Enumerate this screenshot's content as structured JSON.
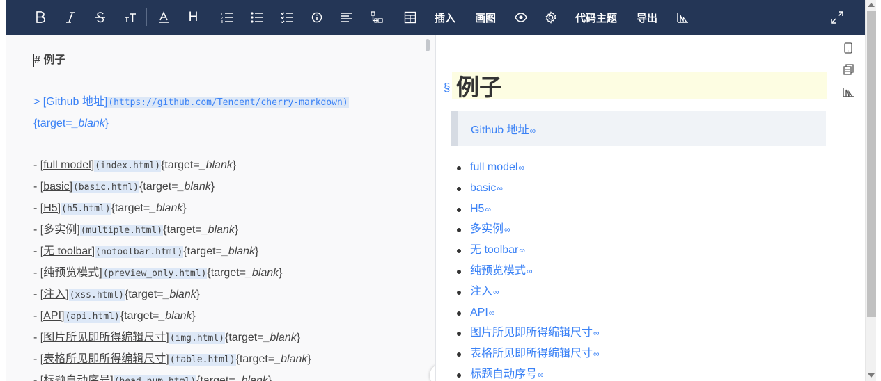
{
  "toolbar": {
    "insert_label": "插入",
    "draw_label": "画图",
    "code_theme_label": "代码主题",
    "export_label": "导出",
    "heading_letter": "H"
  },
  "editor": {
    "heading_line": "# 例子",
    "quote_prefix": "> ",
    "quote_link_text": "[Github 地址]",
    "quote_link_url": "(https://github.com/Tencent/cherry-markdown)",
    "quote_attr_open": "{target=",
    "quote_attr_value": "_blank",
    "quote_attr_close": "}",
    "items": [
      {
        "prefix": "- ",
        "text": "[full model]",
        "url": "(index.html)",
        "attr": "{target=",
        "val": "_blank",
        "close": "}"
      },
      {
        "prefix": "- ",
        "text": "[basic]",
        "url": "(basic.html)",
        "attr": "{target=",
        "val": "_blank",
        "close": "}"
      },
      {
        "prefix": "- ",
        "text": "[H5]",
        "url": "(h5.html)",
        "attr": "{target=",
        "val": "_blank",
        "close": "}"
      },
      {
        "prefix": "- ",
        "text": "[多实例]",
        "url": "(multiple.html)",
        "attr": "{target=",
        "val": "_blank",
        "close": "}"
      },
      {
        "prefix": "- ",
        "text": "[无 toolbar]",
        "url": "(notoolbar.html)",
        "attr": "{target=",
        "val": "_blank",
        "close": "}"
      },
      {
        "prefix": "- ",
        "text": "[纯预览模式]",
        "url": "(preview_only.html)",
        "attr": "{target=",
        "val": "_blank",
        "close": "}"
      },
      {
        "prefix": "- ",
        "text": "[注入]",
        "url": "(xss.html)",
        "attr": "{target=",
        "val": "_blank",
        "close": "}"
      },
      {
        "prefix": "- ",
        "text": "[API]",
        "url": "(api.html)",
        "attr": "{target=",
        "val": "_blank",
        "close": "}"
      },
      {
        "prefix": "- ",
        "text": "[图片所见即所得编辑尺寸]",
        "url": "(img.html)",
        "attr": "{target=",
        "val": "_blank",
        "close": "}"
      },
      {
        "prefix": "- ",
        "text": "[表格所见即所得编辑尺寸]",
        "url": "(table.html)",
        "attr": "{target=",
        "val": "_blank",
        "close": "}"
      },
      {
        "prefix": "- ",
        "text": "[标题自动序号]",
        "url": "(head_num.html)",
        "attr": "{target=",
        "val": "_blank",
        "close": "}"
      }
    ]
  },
  "preview": {
    "anchor_symbol": "§",
    "heading": "例子",
    "quote_link": "Github 地址",
    "list": [
      "full model",
      "basic",
      "H5",
      "多实例",
      "无 toolbar",
      "纯预览模式",
      "注入",
      "API",
      "图片所见即所得编辑尺寸",
      "表格所见即所得编辑尺寸",
      "标题自动序号"
    ]
  },
  "colors": {
    "toolbar_bg": "#243656",
    "link": "#3b82f6",
    "heading_highlight": "#fdfde2",
    "url_highlight": "#dde8f7"
  }
}
